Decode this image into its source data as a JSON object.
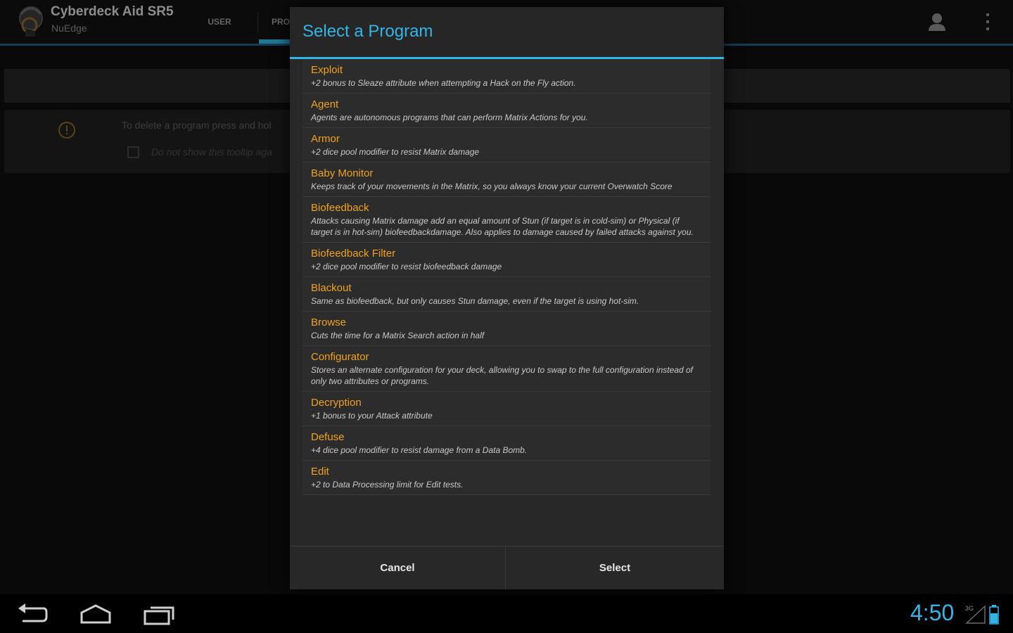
{
  "app": {
    "title": "Cyberdeck Aid SR5",
    "subtitle": "NuEdge",
    "icon": "app-logo-icon"
  },
  "tabs": [
    {
      "label": "USER",
      "selected": false
    },
    {
      "label": "PRO",
      "selected": true
    }
  ],
  "actions": {
    "profile_icon": "person-icon",
    "overflow_icon": "overflow-menu-icon"
  },
  "tooltip": {
    "icon": "info-icon",
    "text": "To delete a program press and hol",
    "checkbox_label": "Do not show this tooltip aga",
    "checked": false
  },
  "dialog": {
    "title": "Select a Program",
    "programs": [
      {
        "name": "Exploit",
        "description": "+2 bonus to Sleaze attribute when attempting a Hack on the Fly action."
      },
      {
        "name": "Agent",
        "description": "Agents are autonomous programs that can perform Matrix Actions for you."
      },
      {
        "name": "Armor",
        "description": "+2 dice pool modifier to resist Matrix damage"
      },
      {
        "name": "Baby Monitor",
        "description": "Keeps track of your movements in the Matrix, so you always know your current Overwatch Score"
      },
      {
        "name": "Biofeedback",
        "description": "Attacks causing Matrix damage add an equal amount of Stun (if target is in cold-sim) or Physical (if target is in hot-sim) biofeedbackdamage. Also applies to damage caused by failed attacks against you."
      },
      {
        "name": "Biofeedback Filter",
        "description": "+2 dice pool modifier to resist biofeedback damage"
      },
      {
        "name": "Blackout",
        "description": "Same as biofeedback, but only causes Stun damage, even if the target is using hot-sim."
      },
      {
        "name": "Browse",
        "description": "Cuts the time for a Matrix Search action in half"
      },
      {
        "name": "Configurator",
        "description": "Stores an alternate configuration for your deck, allowing you to swap to the full configuration instead of only two attributes or programs."
      },
      {
        "name": "Decryption",
        "description": "+1 bonus to your Attack attribute"
      },
      {
        "name": "Defuse",
        "description": "+4 dice pool modifier to resist damage from a Data Bomb."
      },
      {
        "name": "Edit",
        "description": "+2 to Data Processing limit for Edit tests."
      }
    ],
    "cancel_label": "Cancel",
    "select_label": "Select"
  },
  "system": {
    "clock": "4:50",
    "network": "3G",
    "back_icon": "back-icon",
    "home_icon": "home-icon",
    "recents_icon": "recents-icon",
    "signal_icon": "signal-icon",
    "battery_icon": "battery-icon"
  },
  "colors": {
    "accent": "#33b5e5",
    "program_name": "#f0a21f",
    "info_icon": "#b8860b"
  }
}
